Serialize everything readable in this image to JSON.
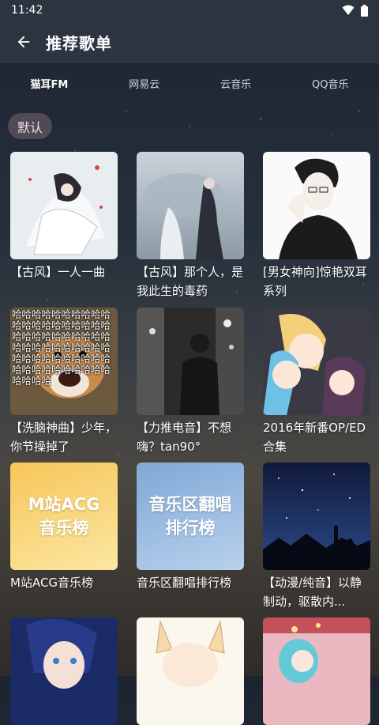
{
  "status_bar": {
    "time": "11:42",
    "wifi_icon": "wifi-icon",
    "battery_icon": "battery-icon"
  },
  "header": {
    "title": "推荐歌单",
    "back_icon": "arrow-left-icon"
  },
  "tabs": [
    {
      "label": "猫耳FM",
      "active": true
    },
    {
      "label": "网易云",
      "active": false
    },
    {
      "label": "云音乐",
      "active": false
    },
    {
      "label": "QQ音乐",
      "active": false
    }
  ],
  "filter_chip": "默认",
  "playlists": [
    {
      "title": "【古风】一人一曲",
      "cover": "girl-white-flowers"
    },
    {
      "title": "【古风】那个人，是我此生的毒药",
      "cover": "umbrella-figures"
    },
    {
      "title": "[男女神向]惊艳双耳系列",
      "cover": "man-black-sweater"
    },
    {
      "title": "【洗脑神曲】少年，你节操掉了",
      "cover": "laughing-dog",
      "cover_text": "哈哈哈哈哈哈哈哈哈哈哈哈哈哈哈哈哈哈哈哈哈哈哈哈哈哈哈哈哈哈哈哈哈哈哈哈哈哈哈哈哈哈哈哈哈哈哈哈哈哈哈哈哈哈哈哈哈哈哈哈哈哈哈哈"
    },
    {
      "title": "【力推电音】不想嗨？tan90°",
      "cover": "man-city-night"
    },
    {
      "title": "2016年新番OP/ED合集",
      "cover": "anime-girls"
    },
    {
      "title": "M站ACG音乐榜",
      "cover": "mzhan-acg",
      "cover_line1": "M站ACG",
      "cover_line2": "音乐榜",
      "colors": [
        "#f7c65a",
        "#fbe7a1"
      ]
    },
    {
      "title": "音乐区翻唱排行榜",
      "cover": "cover-rank",
      "cover_line1": "音乐区翻唱",
      "cover_line2": "排行榜",
      "colors": [
        "#7fa8d6",
        "#b8d1ec"
      ]
    },
    {
      "title": "【动漫/纯音】以静制动，驱散内...",
      "cover": "starry-night-dog"
    },
    {
      "title": "",
      "cover": "anime-boy-blue"
    },
    {
      "title": "",
      "cover": "fox-girl"
    },
    {
      "title": "",
      "cover": "pink-stage-girl"
    }
  ]
}
